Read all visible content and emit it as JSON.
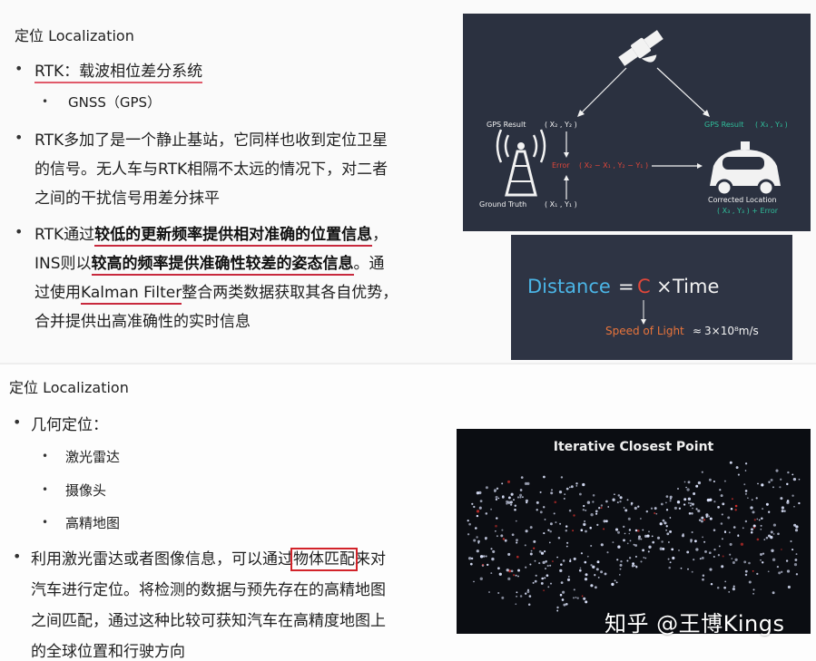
{
  "slide1": {
    "title": "定位 Localization",
    "bullets": {
      "rtk": "RTK：载波相位差分系统",
      "gnss": "GNSS（GPS）",
      "p2_l1": "RTK多加了是一个静止基站，它同样也收到定位卫星",
      "p2_l2": "的信号。无人车与RTK相隔不太远的情况下，对二者",
      "p2_l3": "之间的干扰信号用差分抹平",
      "p3_l1_a": "RTK通过",
      "p3_l1_b": "较低的更新频率提供相对准确的位置信息",
      "p3_l1_c": "，",
      "p3_l2_a": "INS则以",
      "p3_l2_b": "较高的频率提供准确性较差的姿态信息",
      "p3_l2_c": "。通",
      "p3_l3_a": "过使用",
      "p3_l3_b": "Kalman Filter",
      "p3_l3_c": "整合两类数据获取其各自优势，",
      "p3_l4": "合并提供出高准确性的实时信息"
    }
  },
  "gps_diagram": {
    "gps_result_left": "GPS Result",
    "coord_left": "( X₂ , Y₂ )",
    "error": "Error",
    "error_expr": "( X₂ − X₁ , Y₂ − Y₁ )",
    "ground_truth": "Ground Truth",
    "coord_truth": "( X₁ , Y₁ )",
    "gps_result_right": "GPS Result",
    "coord_right": "( X₃ , Y₃ )",
    "corrected": "Corrected Location",
    "corrected_expr": "( X₃ , Y₃ ) + Error",
    "colors": {
      "bg": "#2b3140",
      "green": "#2fbf9b",
      "red": "#e0473a",
      "white": "#f2f2f2"
    },
    "icons": [
      "satellite-icon",
      "tower-icon",
      "car-icon"
    ]
  },
  "distance_panel": {
    "distance": "Distance",
    "equals": "=",
    "c": "C",
    "times": "×",
    "time": "Time",
    "speed_of_light": "Speed of Light",
    "approx": "≈",
    "value": "3×10⁸m/s",
    "colors": {
      "bg": "#2e3444",
      "blue": "#4bb5e6",
      "red": "#e0473a",
      "orange": "#e8743b"
    }
  },
  "slide2": {
    "title": "定位 Localization",
    "bullets": {
      "geo": "几何定位：",
      "lidar": "激光雷达",
      "camera": "摄像头",
      "hdmap": "高精地图",
      "p_l1_a": "利用激光雷达或者图像信息，可以通过",
      "p_l1_b": "物体匹配",
      "p_l1_c": "来对",
      "p_l2": "汽车进行定位。将检测的数据与预先存在的高精地图",
      "p_l3": "之间匹配，通过这种比较可获知汽车在高精度地图上",
      "p_l4": "的全球位置和行驶方向"
    }
  },
  "icp_panel": {
    "title": "Iterative Closest Point",
    "colors": {
      "bg": "#0b0d12",
      "points": "#dfe6ff",
      "red_points": "#d2302c"
    }
  },
  "watermark": "知乎 @王博Kings"
}
